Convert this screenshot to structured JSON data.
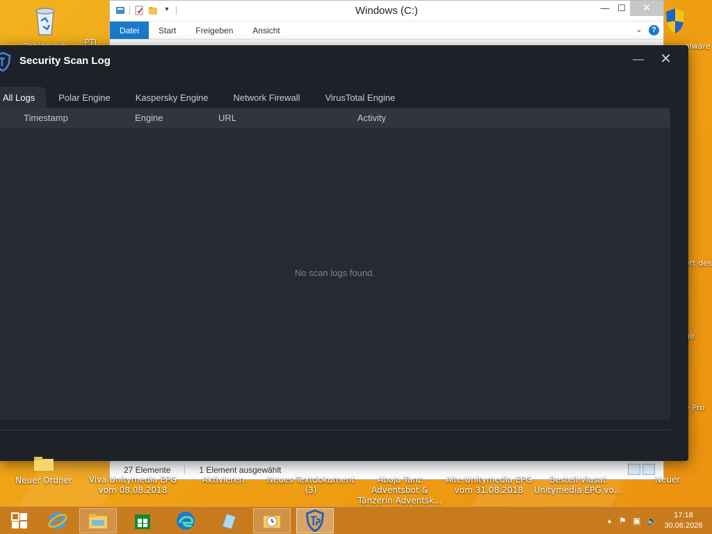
{
  "desktop": {
    "top_icons": [
      {
        "label": "Papierkorb"
      },
      {
        "label": "PTI"
      }
    ],
    "bottom_icons": [
      {
        "label": "Neuer Ordner"
      },
      {
        "label": "Viva Unitymedia EPG vom 08.08.2018"
      },
      {
        "label": "Aktivieren"
      },
      {
        "label": "Neues Textdokument (3)"
      },
      {
        "label": "Abaja Tanz Adventsbot & Tänzerin Adventsk..."
      },
      {
        "label": "Alte Unitymedia EPG vom 31.08.2018"
      },
      {
        "label": "Bestell Viasat Unitymedia EPG vo..."
      },
      {
        "label": "Neuer"
      }
    ],
    "side_labels": [
      {
        "label": "alware"
      },
      {
        "label": "ert des"
      },
      {
        "label": "ge"
      },
      {
        "label": "e Pro"
      }
    ]
  },
  "explorer": {
    "title": "Windows (C:)",
    "ribbon_tabs": [
      "Datei",
      "Start",
      "Freigeben",
      "Ansicht"
    ],
    "active_tab": "Datei",
    "status_items": "27 Elemente",
    "status_selected": "1 Element ausgewählt",
    "help": "?"
  },
  "scanlog": {
    "title": "Security Scan Log",
    "minimize_glyph": "—",
    "close_glyph": "✕",
    "tabs": [
      "All Logs",
      "Polar Engine",
      "Kaspersky Engine",
      "Network Firewall",
      "VirusTotal Engine"
    ],
    "active_tab": "All Logs",
    "columns": [
      "Timestamp",
      "Engine",
      "URL",
      "Activity"
    ],
    "empty_message": "No scan logs found."
  },
  "taskbar": {
    "time": "17:18",
    "date": "30.06.2026"
  },
  "colors": {
    "accent": "#1979ca",
    "scan_bg": "#1e2228",
    "panel_bg": "#262a31",
    "header_bg": "#30353e"
  }
}
